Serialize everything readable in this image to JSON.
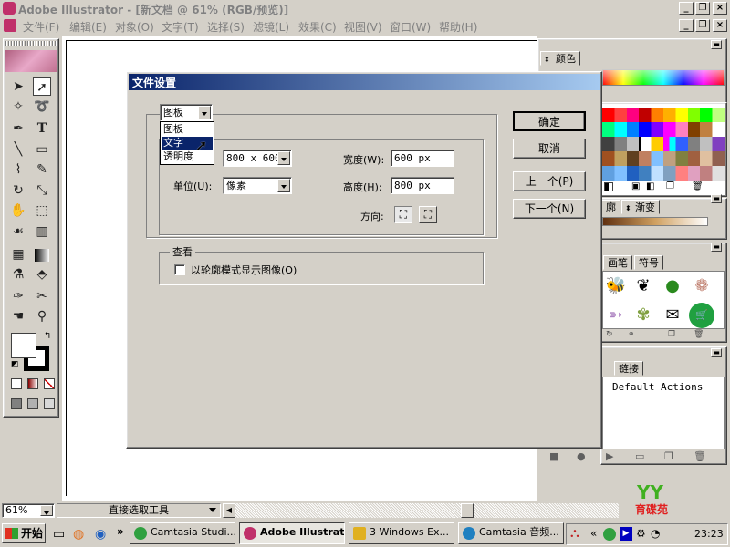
{
  "window": {
    "title": "Adobe Illustrator - [新文档 @ 61% (RGB/预览)]"
  },
  "menu": [
    "文件(F)",
    "编辑(E)",
    "对象(O)",
    "文字(T)",
    "选择(S)",
    "滤镜(L)",
    "效果(C)",
    "视图(V)",
    "窗口(W)",
    "帮助(H)"
  ],
  "dialog": {
    "title": "文件设置",
    "category_selected": "图板",
    "category_options": [
      "图板",
      "文字",
      "透明度"
    ],
    "highlighted_option": "文字",
    "size_value": "800 x 600",
    "units_label": "单位(U):",
    "units_value": "像素",
    "width_label": "宽度(W):",
    "width_value": "600 px",
    "height_label": "高度(H):",
    "height_value": "800 px",
    "orientation_label": "方向:",
    "view_group_label": "查看",
    "outline_checkbox_label": "以轮廓模式显示图像(O)",
    "outline_checked": false,
    "ok_label": "确定",
    "cancel_label": "取消",
    "prev_label": "上一个(P)",
    "next_label": "下一个(N)"
  },
  "panels": {
    "color_tab": "颜色",
    "outline_tab": "廓",
    "gradient_tab": "渐变",
    "brush_tab": "画笔",
    "symbol_tab": "符号",
    "links_tab": "链接",
    "actions_item": "Default Actions"
  },
  "status": {
    "zoom": "61%",
    "tool": "直接选取工具"
  },
  "watermark": "育碟苑",
  "taskbar": {
    "start": "开始",
    "items": [
      "Camtasia Studi...",
      "Adobe Illustrat...",
      "3 Windows Ex...",
      "Camtasia 音频..."
    ],
    "clock": "23:23"
  },
  "colors": {
    "titlebar_active": "#0a246a",
    "titlebar_gradient_end": "#a6caf0",
    "menu_highlight": "#0a246a"
  }
}
